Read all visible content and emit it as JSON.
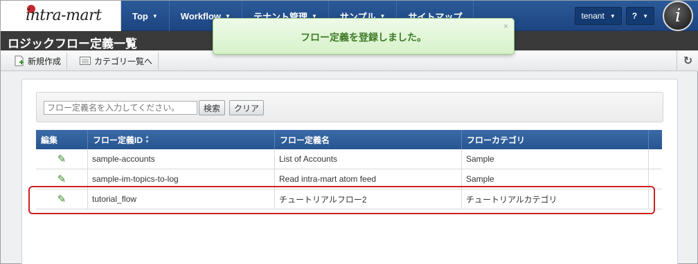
{
  "logo": {
    "text": "intra-mart",
    "mark": "®"
  },
  "nav": {
    "items": [
      {
        "label": "Top"
      },
      {
        "label": "Workflow"
      },
      {
        "label": "テナント管理"
      },
      {
        "label": "サンプル"
      },
      {
        "label": "サイトマップ"
      }
    ],
    "tenant_label": "tenant",
    "help_label": "?",
    "avatar_letter": "i"
  },
  "page": {
    "title": "ロジックフロー定義一覧"
  },
  "toolbar": {
    "new_label": "新規作成",
    "category_label": "カテゴリ一覧へ",
    "refresh_icon": "refresh-icon"
  },
  "toast": {
    "message": "フロー定義を登録しました。",
    "close": "×"
  },
  "search": {
    "placeholder": "フロー定義名を入力してください。",
    "search_label": "検索",
    "clear_label": "クリア"
  },
  "table": {
    "headers": [
      "編集",
      "フロー定義ID",
      "フロー定義名",
      "フローカテゴリ"
    ],
    "rows": [
      {
        "id": "sample-accounts",
        "name": "List of Accounts",
        "category": "Sample"
      },
      {
        "id": "sample-im-topics-to-log",
        "name": "Read intra-mart atom feed",
        "category": "Sample"
      },
      {
        "id": "tutorial_flow",
        "name": "チュートリアルフロー2",
        "category": "チュートリアルカテゴリ"
      }
    ]
  },
  "colors": {
    "nav_bg": "#2b5a9a",
    "title_bg": "#3a3a3a",
    "table_header": "#3a6aa8",
    "toast_text": "#3d7a25",
    "highlight": "#cc2020"
  }
}
